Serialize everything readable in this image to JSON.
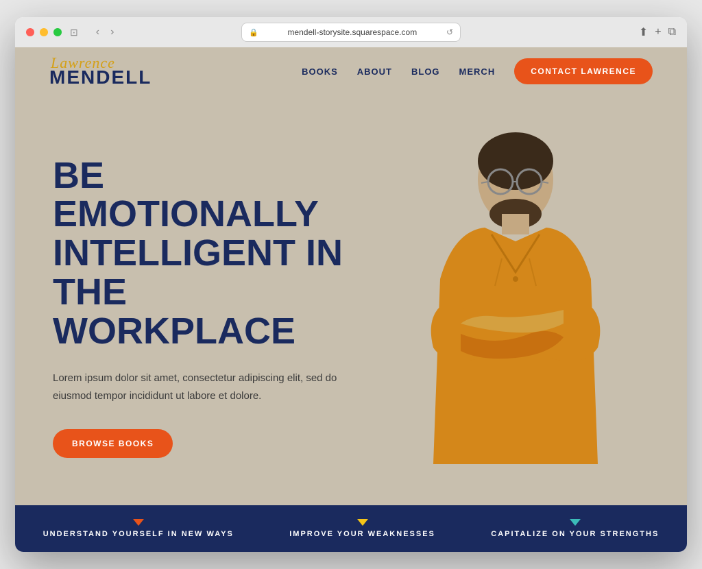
{
  "browser": {
    "address": "mendell-storysite.squarespace.com",
    "back_icon": "‹",
    "forward_icon": "›",
    "window_icon": "⊡",
    "share_icon": "⬆",
    "new_tab_icon": "+",
    "copy_icon": "⧉",
    "reload_icon": "↺"
  },
  "header": {
    "logo_script": "Lawrence",
    "logo_main": "MENDELL",
    "nav": {
      "books": "BOOKS",
      "about": "ABOUT",
      "blog": "BLOG",
      "merch": "MERCH"
    },
    "cta_button": "CONTACT LAWRENCE"
  },
  "hero": {
    "headline_line1": "BE EMOTIONALLY",
    "headline_line2": "INTELLIGENT IN",
    "headline_line3": "THE WORKPLACE",
    "subtext": "Lorem ipsum dolor sit amet, consectetur adipiscing elit, sed do eiusmod tempor incididunt ut labore et dolore.",
    "browse_button": "BROWSE BOOKS"
  },
  "bottom_banner": {
    "items": [
      {
        "label": "UNDERSTAND YOURSELF IN NEW WAYS",
        "arrow_color": "orange"
      },
      {
        "label": "IMPROVE YOUR WEAKNESSES",
        "arrow_color": "yellow"
      },
      {
        "label": "CAPITALIZE ON YOUR STRENGTHS",
        "arrow_color": "teal"
      }
    ]
  },
  "colors": {
    "navy": "#1a2a5e",
    "orange": "#e8531a",
    "yellow": "#f5c518",
    "teal": "#3bbcb8",
    "beige": "#c8bfae",
    "gold": "#d4a017"
  }
}
